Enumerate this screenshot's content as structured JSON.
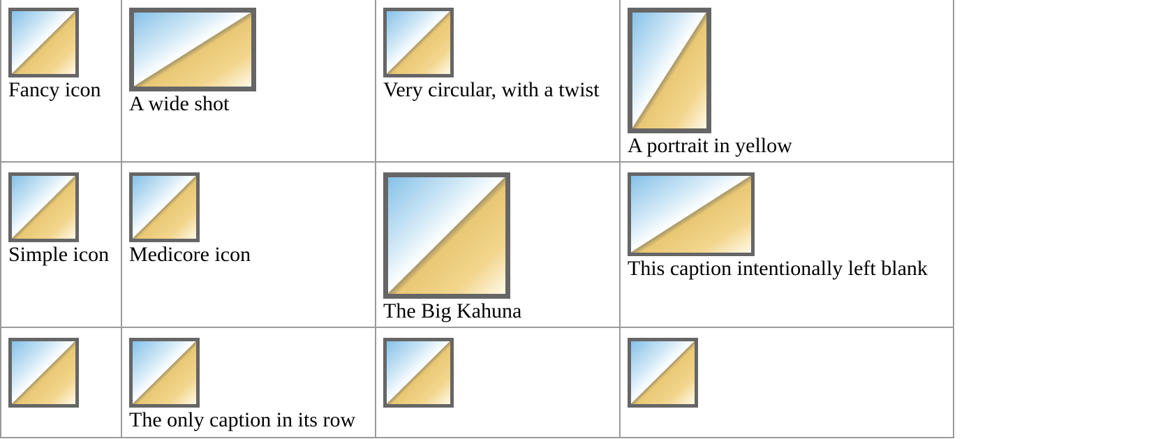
{
  "gallery": {
    "rows": [
      {
        "cells": [
          {
            "thumbnail": "icon-thumbnail",
            "caption": "Fancy icon"
          },
          {
            "thumbnail": "wide-thumbnail",
            "caption": "A wide shot"
          },
          {
            "thumbnail": "icon-thumbnail",
            "caption": "Very circular, with a twist"
          },
          {
            "thumbnail": "portrait-thumbnail",
            "caption": "A portrait in yellow"
          }
        ]
      },
      {
        "cells": [
          {
            "thumbnail": "icon-thumbnail",
            "caption": "Simple icon"
          },
          {
            "thumbnail": "icon-thumbnail",
            "caption": "Medicore icon"
          },
          {
            "thumbnail": "large-thumbnail",
            "caption": "The Big Kahuna"
          },
          {
            "thumbnail": "wide-thumbnail",
            "caption": "This caption intentionally left blank"
          }
        ]
      },
      {
        "cells": [
          {
            "thumbnail": "icon-thumbnail",
            "caption": ""
          },
          {
            "thumbnail": "icon-thumbnail",
            "caption": "The only caption in its row"
          },
          {
            "thumbnail": "icon-thumbnail",
            "caption": ""
          },
          {
            "thumbnail": "icon-thumbnail",
            "caption": ""
          }
        ]
      }
    ]
  },
  "colors": {
    "border": "#9a9a9a",
    "frame": "#666666",
    "sky": "#86c1e8",
    "sand": "#e9c874"
  }
}
